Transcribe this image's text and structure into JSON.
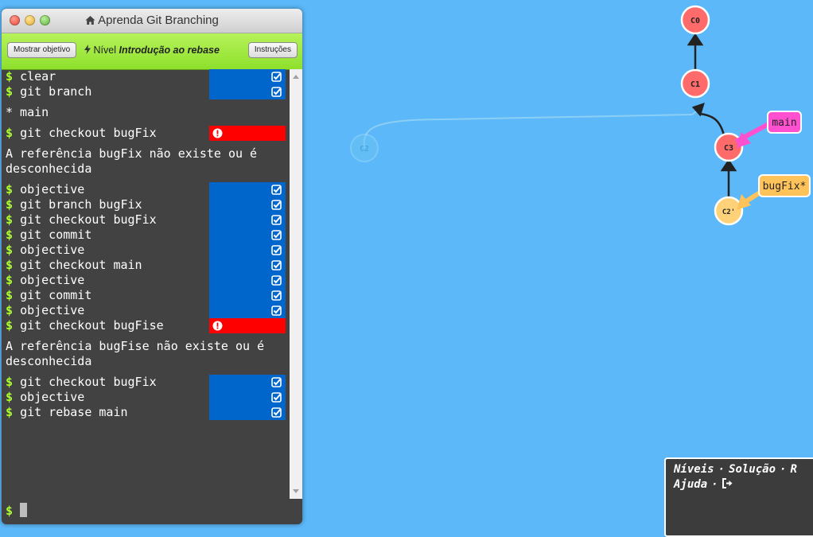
{
  "window": {
    "title": "Aprenda Git Branching",
    "home_icon": "home-icon"
  },
  "toolbar": {
    "objective_label": "Mostrar objetivo",
    "level_prefix": "Nível",
    "level_name": "Introdução ao rebase",
    "instructions_label": "Instruções",
    "bolt_icon": "bolt-icon"
  },
  "log": [
    {
      "type": "cmd",
      "text": "clear",
      "status": "ok"
    },
    {
      "type": "cmd",
      "text": "git branch",
      "status": "ok"
    },
    {
      "type": "msg",
      "text": "* main"
    },
    {
      "type": "cmd",
      "text": "git checkout bugFix",
      "status": "error"
    },
    {
      "type": "msg",
      "text": "A referência bugFix não existe ou é desconhecida"
    },
    {
      "type": "cmd",
      "text": "objective",
      "status": "ok"
    },
    {
      "type": "cmd",
      "text": "git branch bugFix",
      "status": "ok"
    },
    {
      "type": "cmd",
      "text": "git checkout bugFix",
      "status": "ok"
    },
    {
      "type": "cmd",
      "text": "git commit",
      "status": "ok"
    },
    {
      "type": "cmd",
      "text": "objective",
      "status": "ok"
    },
    {
      "type": "cmd",
      "text": "git checkout main",
      "status": "ok"
    },
    {
      "type": "cmd",
      "text": "objective",
      "status": "ok"
    },
    {
      "type": "cmd",
      "text": "git commit",
      "status": "ok"
    },
    {
      "type": "cmd",
      "text": "objective",
      "status": "ok"
    },
    {
      "type": "cmd",
      "text": "git checkout bugFise",
      "status": "error"
    },
    {
      "type": "msg",
      "text": "A referência bugFise não existe ou é desconhecida"
    },
    {
      "type": "cmd",
      "text": "git checkout bugFix",
      "status": "ok"
    },
    {
      "type": "cmd",
      "text": "objective",
      "status": "ok"
    },
    {
      "type": "cmd",
      "text": "git rebase main",
      "status": "ok"
    }
  ],
  "prompt": {
    "symbol": "$"
  },
  "colors": {
    "background": "#5cb8f8",
    "terminal": "#424242",
    "status_ok": "#0066cc",
    "status_error": "#ff0000",
    "prompt": "#adff2f",
    "commit_main": "#ff6b6b",
    "commit_bugfix": "#ffd27a",
    "label_main": "#ff50d0",
    "label_bugfix": "#ffc35a"
  },
  "graph": {
    "commits": [
      {
        "id": "C0",
        "branch": "main"
      },
      {
        "id": "C1",
        "branch": "main"
      },
      {
        "id": "C3",
        "branch": "main"
      },
      {
        "id": "C2'",
        "branch": "bugFix"
      },
      {
        "id": "C2",
        "branch": "orphaned"
      }
    ],
    "branches": [
      {
        "name": "main",
        "points_to": "C3"
      },
      {
        "name": "bugFix*",
        "points_to": "C2'"
      }
    ]
  },
  "help": {
    "levels": "Níveis",
    "solution": "Solução",
    "reset_partial": "R",
    "help": "Ajuda",
    "exit_icon": "exit-icon",
    "separator": "·"
  }
}
